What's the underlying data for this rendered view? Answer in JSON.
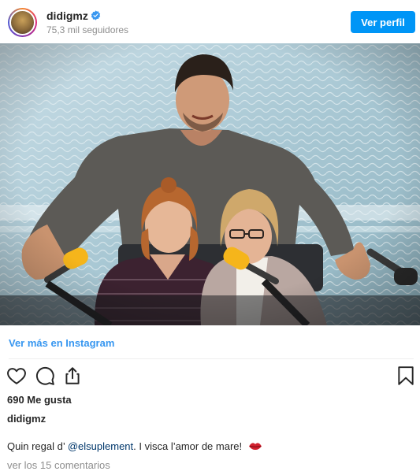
{
  "header": {
    "username": "didigmz",
    "followers": "75,3 mil seguidores",
    "view_profile_label": "Ver perfil"
  },
  "post": {
    "view_more_label": "Ver más en Instagram",
    "likes": "690 Me gusta",
    "owner": "didigmz",
    "caption_prefix": "Quin regal d’ ",
    "caption_mention": "@elsuplement",
    "caption_suffix": ". I visca l’amor de mare!",
    "comments_link": "ver los 15 comentarios"
  },
  "icons": {
    "verified": "verified-badge-icon",
    "like": "heart-icon",
    "comment": "comment-icon",
    "share": "share-icon",
    "save": "bookmark-icon",
    "caption_emoji": "lips-emoji-icon"
  },
  "colors": {
    "accent": "#0095f6",
    "link": "#3897f0",
    "mention": "#00376b",
    "muted": "#8e8e8e"
  }
}
